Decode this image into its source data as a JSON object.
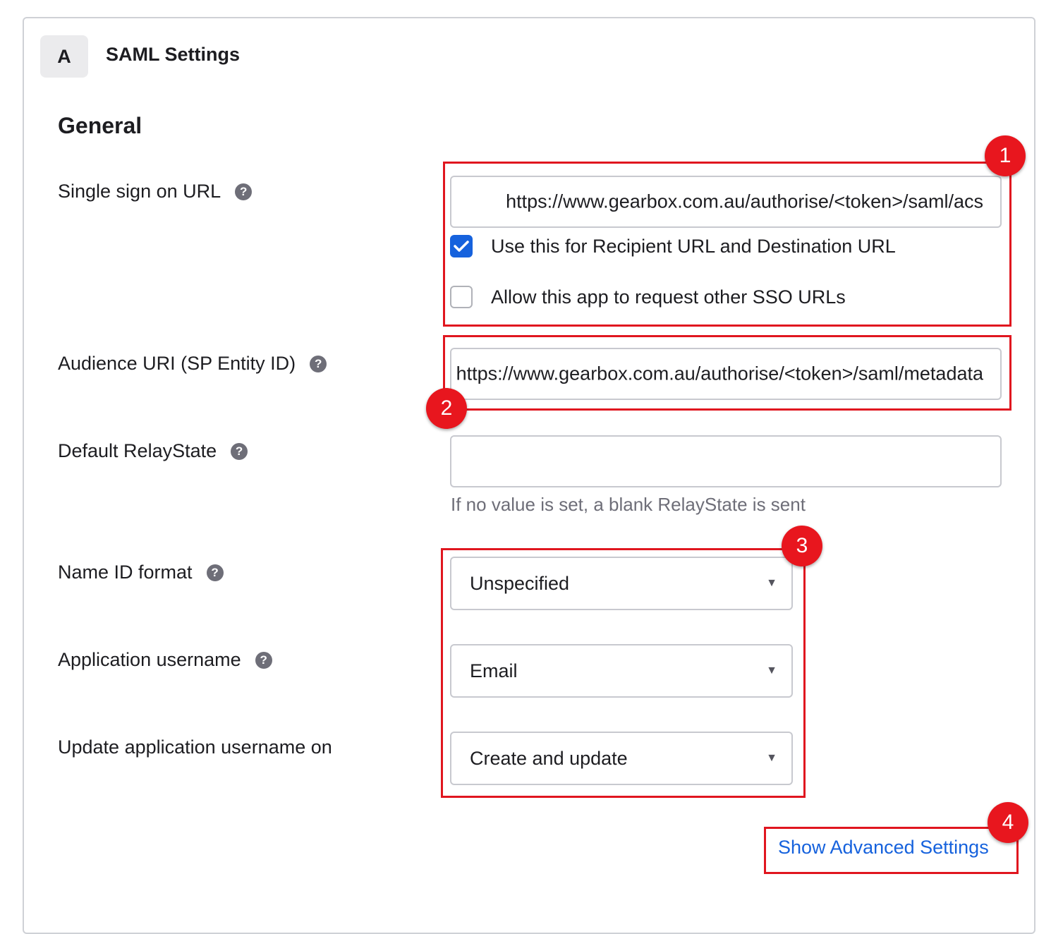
{
  "header": {
    "step": "A",
    "title": "SAML Settings"
  },
  "section": {
    "title": "General"
  },
  "fields": {
    "sso_url": {
      "label": "Single sign on URL",
      "value": "https://www.gearbox.com.au/authorise/<token>/saml/acs",
      "check_recipient": "Use this for Recipient URL and Destination URL",
      "check_recipient_checked": true,
      "check_other_sso": "Allow this app to request other SSO URLs",
      "check_other_sso_checked": false
    },
    "audience_uri": {
      "label": "Audience URI (SP Entity ID)",
      "value": "https://www.gearbox.com.au/authorise/<token>/saml/metadata"
    },
    "relay_state": {
      "label": "Default RelayState",
      "value": "",
      "hint": "If no value is set, a blank RelayState is sent"
    },
    "name_id_format": {
      "label": "Name ID format",
      "value": "Unspecified"
    },
    "app_username": {
      "label": "Application username",
      "value": "Email"
    },
    "update_username": {
      "label": "Update application username on",
      "value": "Create and update"
    }
  },
  "advanced_link": "Show Advanced Settings",
  "callouts": [
    "1",
    "2",
    "3",
    "4"
  ],
  "colors": {
    "accent": "#1662dd",
    "callout": "#e0161f"
  },
  "icons": {
    "help": "question-circle-icon",
    "caret": "caret-down-icon",
    "check": "checkmark-icon"
  }
}
